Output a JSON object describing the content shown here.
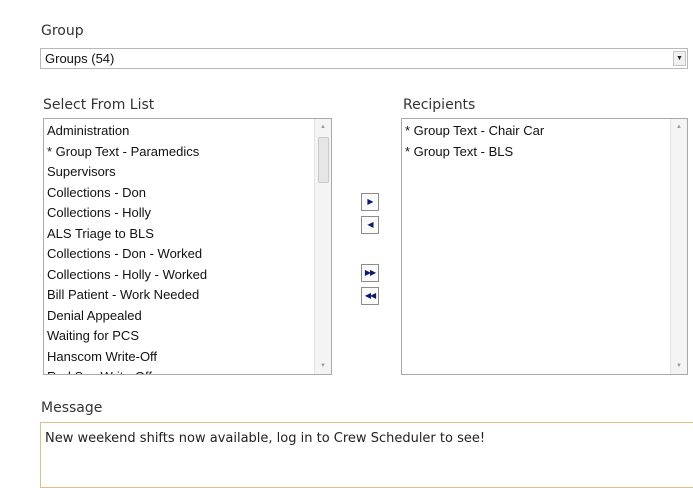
{
  "group": {
    "label": "Group",
    "selected": "Groups (54)",
    "dropdown_icon": "chevron-down-icon"
  },
  "select_list": {
    "label": "Select From List",
    "items": [
      "Administration",
      "* Group Text - Paramedics",
      "Supervisors",
      "Collections - Don",
      "Collections - Holly",
      "ALS Triage to BLS",
      "Collections - Don - Worked",
      "Collections - Holly - Worked",
      "Bill Patient - Work Needed",
      "Denial Appealed",
      "Waiting for PCS",
      "Hanscom Write-Off",
      "Red Sox Write-Off"
    ]
  },
  "recipients": {
    "label": "Recipients",
    "items": [
      "* Group Text - Chair Car",
      "* Group Text - BLS"
    ]
  },
  "move_buttons": {
    "add_one": "▶",
    "remove_one": "◀",
    "add_all": "▶▶",
    "remove_all": "◀◀"
  },
  "message": {
    "label": "Message",
    "value": "New weekend shifts now available, log in to Crew Scheduler to see!"
  },
  "colors": {
    "message_border": "#e0bf86",
    "arrow": "#0b1a6e"
  }
}
